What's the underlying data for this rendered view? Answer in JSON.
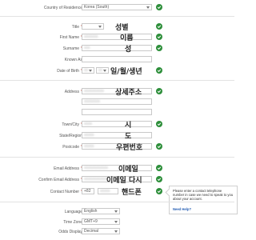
{
  "residence": {
    "label": "Country of Residence",
    "value": "Korea (South)"
  },
  "title": {
    "label": "Title",
    "value": "",
    "annotation": "성별"
  },
  "first_name": {
    "label": "First Name",
    "annotation": "이름"
  },
  "surname": {
    "label": "Surname",
    "annotation": "성"
  },
  "known_as": {
    "label": "Known As"
  },
  "dob": {
    "label": "Date of Birth",
    "annotation": "일/월/생년"
  },
  "address": {
    "label": "Address",
    "annotation": "상세주소"
  },
  "town": {
    "label": "Town/City",
    "annotation": "시"
  },
  "state": {
    "label": "State/Region",
    "annotation": "도"
  },
  "postcode": {
    "label": "Postcode",
    "annotation": "우편번호"
  },
  "email": {
    "label": "Email Address",
    "annotation": "이메일"
  },
  "confirm_email": {
    "label": "Confirm Email Address",
    "annotation": "이메일 다시"
  },
  "contact": {
    "label": "Contact Number",
    "prefix": "+82",
    "annotation": "핸드폰"
  },
  "tooltip": {
    "text": "Please enter a contact telephone number in case we need to speak to you about your account.",
    "help": "Need Help?"
  },
  "language": {
    "label": "Language",
    "value": "English"
  },
  "timezone": {
    "label": "Time Zone",
    "value": "GMT+9"
  },
  "odds": {
    "label": "Odds Display",
    "value": "Decimal"
  },
  "colors": {
    "accent_green": "#2e8f3b",
    "required_red": "#c0392b"
  }
}
